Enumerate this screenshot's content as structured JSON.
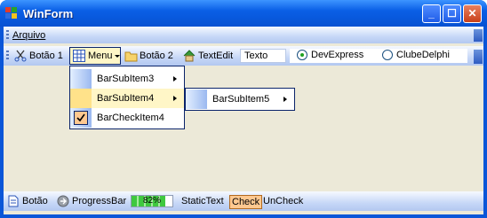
{
  "window": {
    "title": "WinForm"
  },
  "titlebar": {
    "minimize_glyph": "_",
    "maximize_glyph": "☐",
    "close_glyph": "✕"
  },
  "menubar": {
    "items": [
      {
        "label": "Arquivo"
      }
    ]
  },
  "toolbar": {
    "button1": {
      "label": "Botão 1",
      "icon": "scissors-icon"
    },
    "menu": {
      "label": "Menu",
      "icon": "grid-icon"
    },
    "button2": {
      "label": "Botão 2",
      "icon": "folder-icon"
    },
    "textedit": {
      "label": "TextEdit",
      "icon": "house-icon",
      "value": "Texto"
    },
    "radio": [
      {
        "label": "DevExpress",
        "selected": true
      },
      {
        "label": "ClubeDelphi",
        "selected": false
      }
    ]
  },
  "dropdown": {
    "items": [
      {
        "label": "BarSubItem3",
        "has_submenu": true
      },
      {
        "label": "BarSubItem4",
        "has_submenu": true
      },
      {
        "label": "BarCheckItem4",
        "checked": true
      }
    ],
    "submenu": {
      "items": [
        {
          "label": "BarSubItem5",
          "has_submenu": true
        }
      ]
    }
  },
  "statusbar": {
    "botao": {
      "label": "Botão",
      "icon": "document-icon"
    },
    "progressbar": {
      "label": "ProgressBar",
      "icon": "arrow-circle-icon",
      "value_text": "82%",
      "fraction": 0.82
    },
    "static_text": "StaticText",
    "check": "Check",
    "uncheck": "UnCheck"
  },
  "colors": {
    "titlebar": "#0a5fe6",
    "client_bg": "#ece9d8",
    "highlight": "#fff6c7",
    "check_bg": "#ffc890"
  }
}
